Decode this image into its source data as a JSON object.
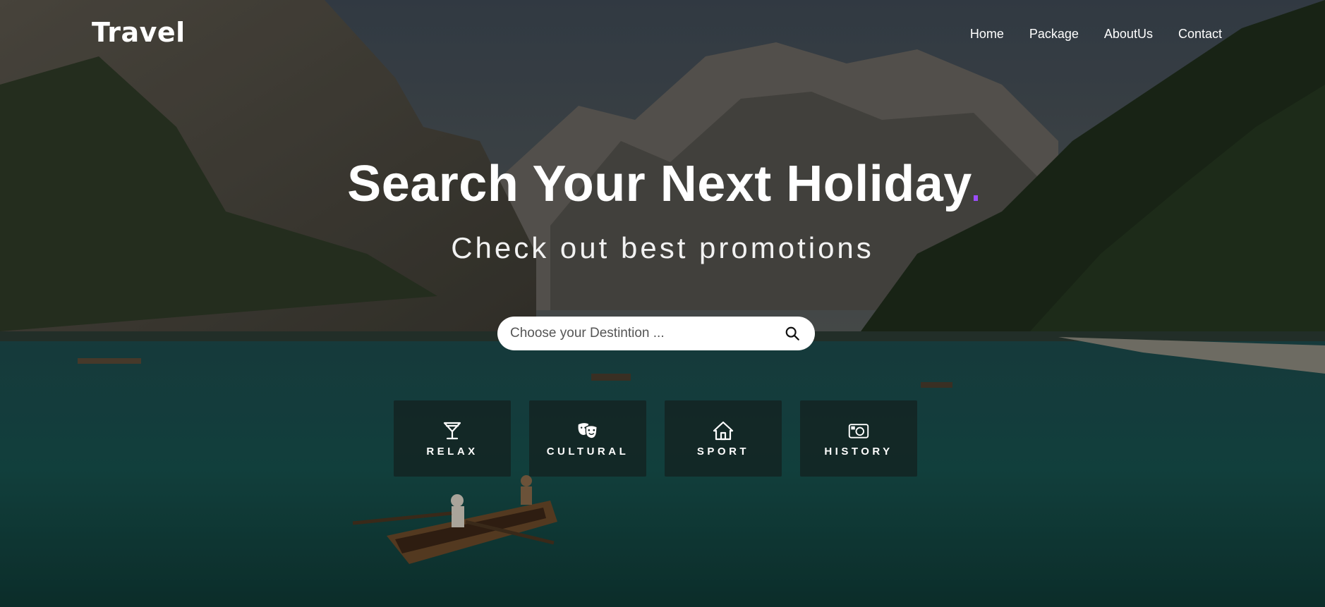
{
  "brand": {
    "logo": "Travel"
  },
  "nav": {
    "items": [
      "Home",
      "Package",
      "AboutUs",
      "Contact"
    ]
  },
  "hero": {
    "headline_prefix": "Search Your Next ",
    "headline_highlight": "Holiday",
    "subheadline": "Check out best promotions",
    "accent_color": "#9b4dfb"
  },
  "search": {
    "placeholder": "Choose your Destintion ...",
    "icon": "search-icon"
  },
  "categories": [
    {
      "label": "RELAX",
      "icon": "cocktail-icon"
    },
    {
      "label": "CULTURAL",
      "icon": "theater-masks-icon"
    },
    {
      "label": "SPORT",
      "icon": "home-icon"
    },
    {
      "label": "HISTORY",
      "icon": "camera-icon"
    }
  ]
}
